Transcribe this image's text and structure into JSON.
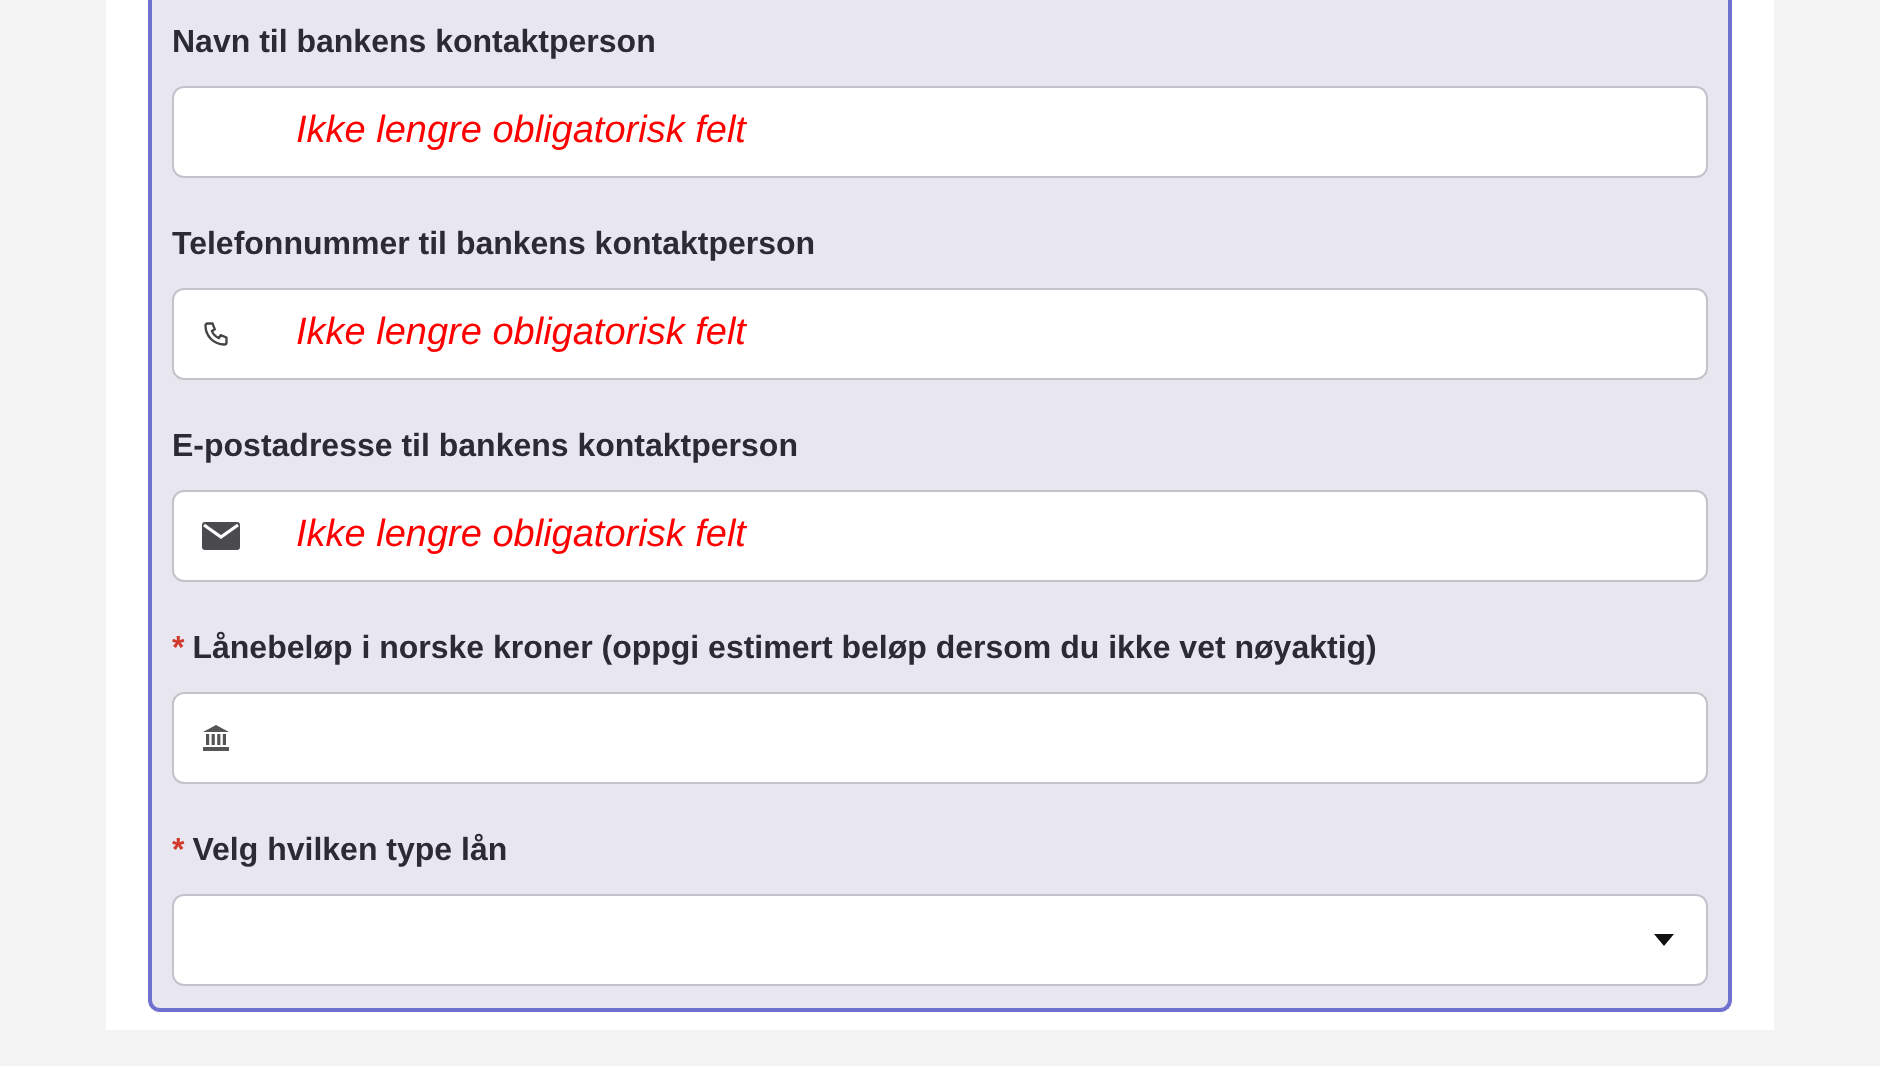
{
  "fields": [
    {
      "label": "Navn til bankens kontaktperson",
      "kind": "text",
      "placeholder": "Ikke lengre obligatorisk felt"
    },
    {
      "label": "Telefonnummer til bankens kontaktperson",
      "kind": "phone",
      "placeholder": "Ikke lengre obligatorisk felt"
    },
    {
      "label": "E-postadresse til bankens kontaktperson",
      "kind": "email",
      "placeholder": "Ikke lengre obligatorisk felt"
    },
    {
      "required_mark": "*",
      "label": "Lånebeløp i norske kroner (oppgi estimert beløp dersom du ikke vet nøyaktig)",
      "kind": "amount"
    },
    {
      "required_mark": "*",
      "label": "Velg hvilken type lån",
      "kind": "select"
    }
  ]
}
